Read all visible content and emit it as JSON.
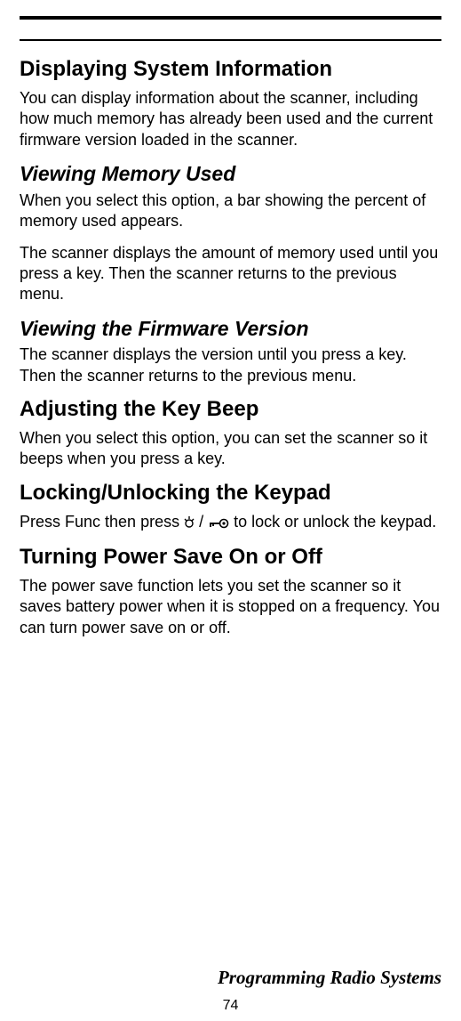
{
  "h1_1": "Displaying System Information",
  "p1": "You can display information about the scanner, including how much memory has already been used and the cur­rent firmware version loaded in the scanner.",
  "h2_1": "Viewing Memory Used",
  "p2": "When you select this option, a bar showing the percent of memory used appears.",
  "p3": "The scanner displays the amount of memory used until you press a key. Then the scanner returns to the previous menu.",
  "h2_2": "Viewing the Firmware Version",
  "p4": "The scanner displays the version until you press a key. Then the scanner returns to the previous menu.",
  "h1_2": "Adjusting the Key Beep",
  "p5": "When you select this option, you can set the scanner so it beeps when you press a key.",
  "h1_3": "Locking/Unlocking the Keypad",
  "p6a": "Press Func then press ",
  "p6b": " to lock or unlock the key­pad.",
  "h1_4": "Turning Power Save On or Off",
  "p7": "The power save function lets you set the scanner so it saves battery power when it is stopped on a frequency. You can turn power save on or off.",
  "footer": "Programming Radio Systems",
  "page": "74"
}
